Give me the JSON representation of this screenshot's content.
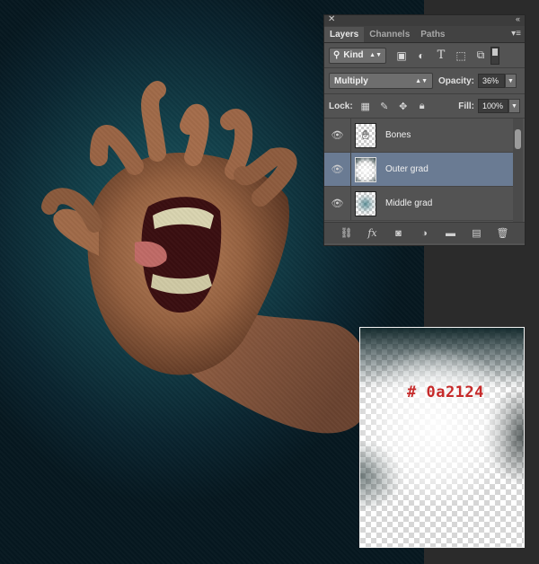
{
  "panel": {
    "tabs": [
      {
        "label": "Layers",
        "active": true
      },
      {
        "label": "Channels",
        "active": false
      },
      {
        "label": "Paths",
        "active": false
      }
    ],
    "filter": {
      "kind_label": "Kind"
    },
    "blend_mode": "Multiply",
    "opacity_label": "Opacity:",
    "opacity_value": "36%",
    "lock_label": "Lock:",
    "fill_label": "Fill:",
    "fill_value": "100%",
    "layers": [
      {
        "name": "Bones",
        "selected": false
      },
      {
        "name": "Outer grad",
        "selected": true
      },
      {
        "name": "Middle grad",
        "selected": false
      }
    ]
  },
  "inset": {
    "color_label": "# 0a2124",
    "color_hex": "#0a2124"
  },
  "colors": {
    "selected_row": "#6a7b93",
    "panel_bg": "#535353",
    "label_red": "#c62a2a"
  }
}
